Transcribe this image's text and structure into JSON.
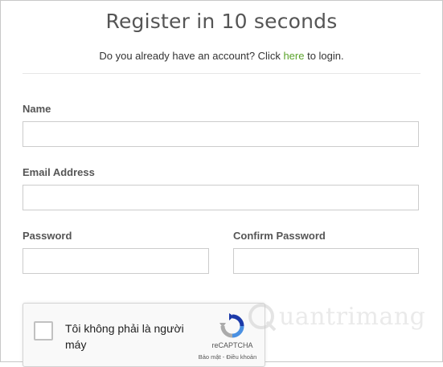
{
  "form": {
    "title": "Register in 10 seconds",
    "subtitle_before": "Do you already have an account? Click ",
    "subtitle_link": "here",
    "subtitle_after": " to login.",
    "fields": {
      "name": {
        "label": "Name",
        "value": ""
      },
      "email": {
        "label": "Email Address",
        "value": ""
      },
      "password": {
        "label": "Password",
        "value": ""
      },
      "confirm_password": {
        "label": "Confirm Password",
        "value": ""
      }
    }
  },
  "recaptcha": {
    "checkbox_label": "Tôi không phải là người máy",
    "brand": "reCAPTCHA",
    "terms": "Bảo mật - Điều khoản",
    "icon": "recaptcha-logo-icon"
  },
  "watermark": {
    "text": "uantrimang",
    "icon": "quantrimang-logo-icon"
  },
  "colors": {
    "link": "#5aa32a",
    "title": "#555555",
    "label": "#555555",
    "border": "#cccccc"
  }
}
